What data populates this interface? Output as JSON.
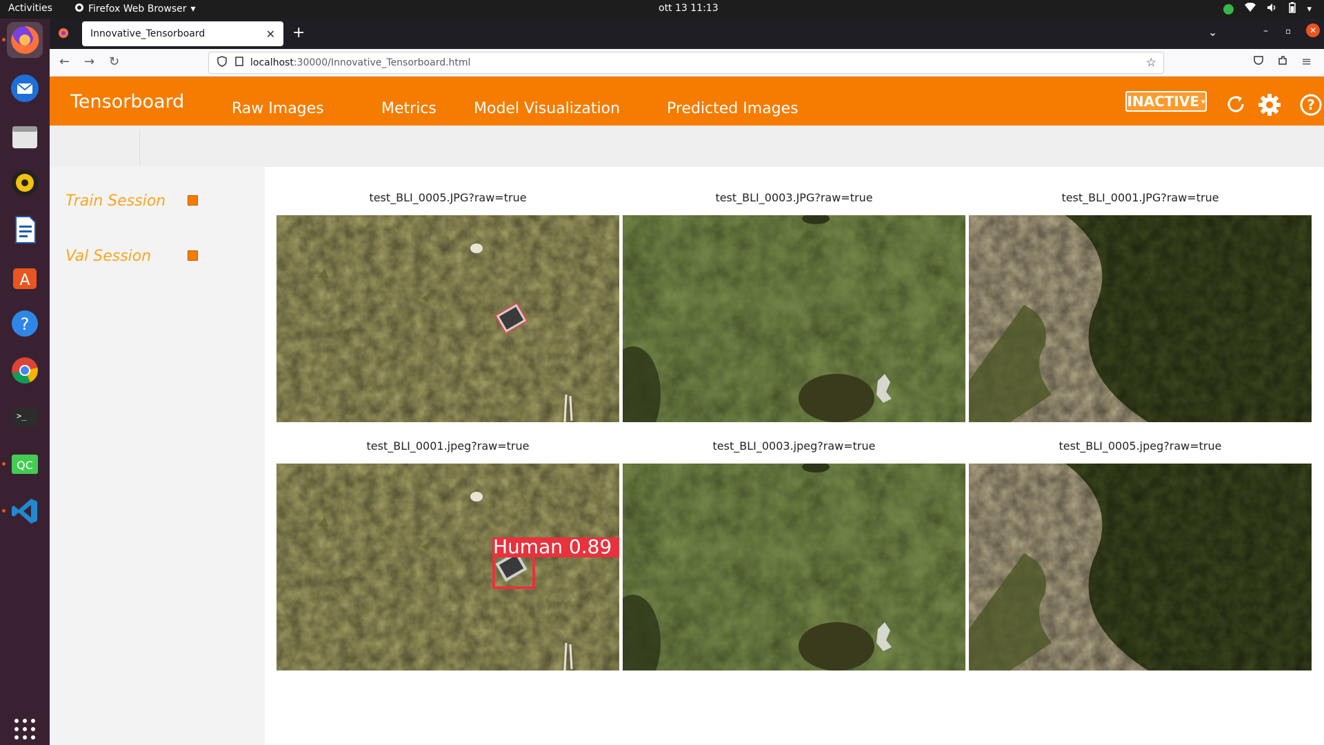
{
  "system": {
    "activities": "Activities",
    "app_menu": "Firefox Web Browser",
    "clock": "ott 13  11:13"
  },
  "browser": {
    "tab_title": "Innovative_Tensorboard",
    "url_host": "localhost",
    "url_rest": ":30000/Innovative_Tensorboard.html"
  },
  "header": {
    "brand": "Tensorboard",
    "nav": [
      "Raw Images",
      "Metrics",
      "Model Visualization",
      "Predicted Images"
    ],
    "status": "INACTIVE"
  },
  "sidebar": {
    "sessions": [
      "Train Session",
      "Val Session"
    ]
  },
  "images": [
    {
      "title": "test_BLI_0005.JPG?raw=true",
      "scene": "grass-light",
      "object": "box"
    },
    {
      "title": "test_BLI_0003.JPG?raw=true",
      "scene": "grass-green",
      "object": ""
    },
    {
      "title": "test_BLI_0001.JPG?raw=true",
      "scene": "grass-dark",
      "object": ""
    },
    {
      "title": "test_BLI_0001.jpeg?raw=true",
      "scene": "grass-light",
      "object": "detection"
    },
    {
      "title": "test_BLI_0003.jpeg?raw=true",
      "scene": "grass-green",
      "object": ""
    },
    {
      "title": "test_BLI_0005.jpeg?raw=true",
      "scene": "grass-dark",
      "object": ""
    }
  ],
  "detection": {
    "label": "Human  0.89"
  },
  "colors": {
    "accent": "#f57c00",
    "session_text": "#f5a623",
    "detection": "#e8323c"
  }
}
